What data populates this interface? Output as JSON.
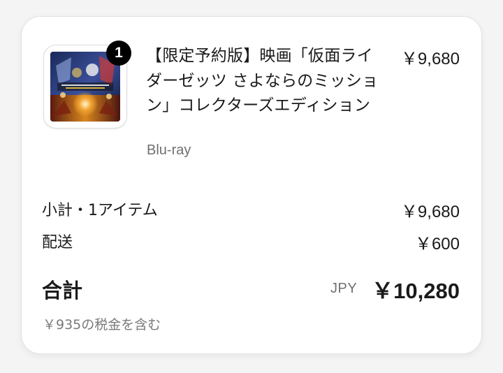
{
  "order": {
    "item": {
      "quantity": "1",
      "title": "【限定予約版】映画「仮面ライダーゼッツ さよならのミッション」コレクターズエディション",
      "format": "Blu-ray",
      "price": "￥9,680",
      "thumbnail_icon": "product-cover-image"
    },
    "summary": {
      "subtotal_label": "小計・1アイテム",
      "subtotal_value": "￥9,680",
      "shipping_label": "配送",
      "shipping_value": "￥600",
      "total_label": "合計",
      "currency": "JPY",
      "total_value": "￥10,280",
      "tax_note": "￥935の税金を含む"
    }
  },
  "colors": {
    "page_background": "#f4f4f4",
    "card_background": "#ffffff",
    "badge_background": "#000000",
    "muted_text": "#707070"
  }
}
